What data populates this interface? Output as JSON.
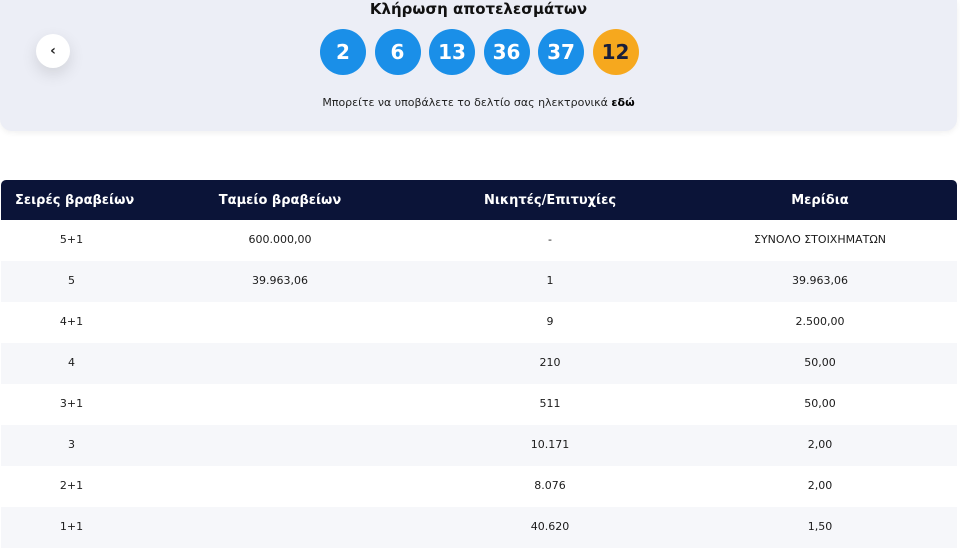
{
  "header": {
    "title": "Κλήρωση αποτελεσμάτων",
    "balls": [
      "2",
      "6",
      "13",
      "36",
      "37"
    ],
    "joker": "12",
    "submit_text": "Μπορείτε να υποβάλετε το δελτίο σας ηλεκτρονικά ",
    "submit_link": "εδώ",
    "back_icon": "chevron-left-icon"
  },
  "table": {
    "columns": [
      "Σειρές βραβείων",
      "Ταμείο βραβείων",
      "Νικητές/Επιτυχίες",
      "Μερίδια"
    ],
    "rows": [
      [
        "5+1",
        "600.000,00",
        "-",
        "ΣΥΝΟΛΟ ΣΤΟΙΧΗΜΑΤΩΝ"
      ],
      [
        "5",
        "39.963,06",
        "1",
        "39.963,06"
      ],
      [
        "4+1",
        "",
        "9",
        "2.500,00"
      ],
      [
        "4",
        "",
        "210",
        "50,00"
      ],
      [
        "3+1",
        "",
        "511",
        "50,00"
      ],
      [
        "3",
        "",
        "10.171",
        "2,00"
      ],
      [
        "2+1",
        "",
        "8.076",
        "2,00"
      ],
      [
        "1+1",
        "",
        "40.620",
        "1,50"
      ]
    ]
  }
}
